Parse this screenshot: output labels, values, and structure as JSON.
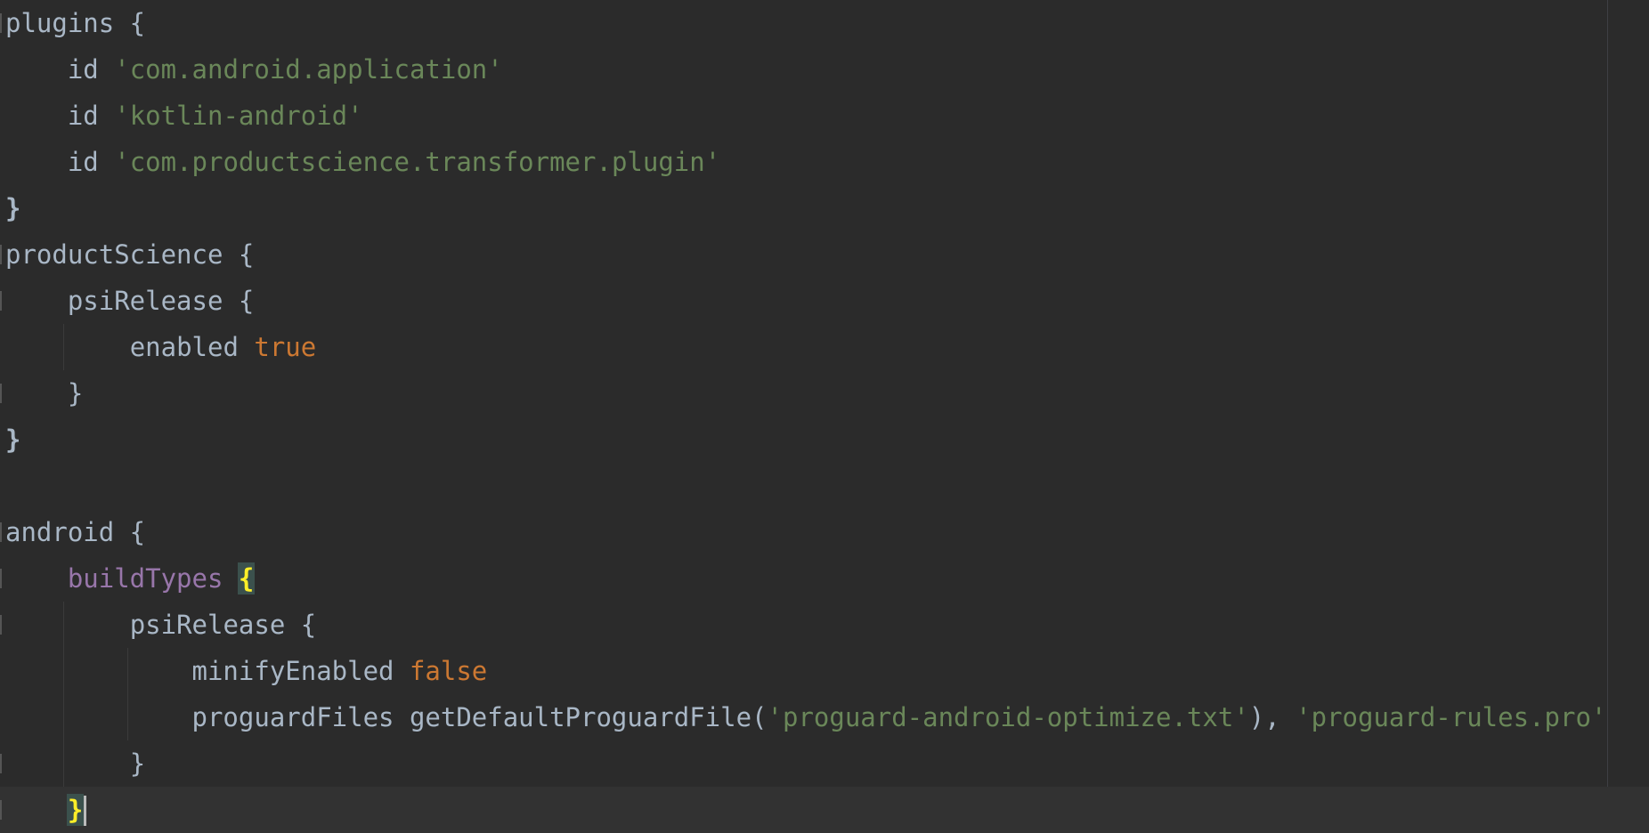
{
  "editor": {
    "lines": [
      {
        "indent": 0,
        "text": "plugins {"
      },
      {
        "indent": 1,
        "keyword": "id",
        "string": "'com.android.application'"
      },
      {
        "indent": 1,
        "keyword": "id",
        "string": "'kotlin-android'"
      },
      {
        "indent": 1,
        "keyword": "id",
        "string": "'com.productscience.transformer.plugin'"
      },
      {
        "indent": 0,
        "text": "}"
      },
      {
        "indent": 0,
        "text": "productScience {"
      },
      {
        "indent": 1,
        "text": "psiRelease {"
      },
      {
        "indent": 2,
        "keyword": "enabled",
        "value": "true"
      },
      {
        "indent": 1,
        "text": "}"
      },
      {
        "indent": 0,
        "text": "}"
      },
      {
        "indent": 0,
        "text": ""
      },
      {
        "indent": 0,
        "text": "android {"
      },
      {
        "indent": 1,
        "identifier": "buildTypes",
        "brace": "{"
      },
      {
        "indent": 2,
        "text": "psiRelease {"
      },
      {
        "indent": 3,
        "keyword": "minifyEnabled",
        "value": "false"
      },
      {
        "indent": 3,
        "prefix": "proguardFiles getDefaultProguardFile(",
        "string1": "'proguard-android-optimize.txt'",
        "middle": "), ",
        "string2": "'proguard-rules.pro'"
      },
      {
        "indent": 2,
        "text": "}"
      },
      {
        "indent": 1,
        "brace": "}"
      }
    ],
    "gutter": {
      "intention_icon": "lightbulb-icon",
      "intention_color": "#f2c55c"
    },
    "colors": {
      "background": "#2b2b2b",
      "current_line": "#323232",
      "text": "#a9b7c6",
      "string": "#6a8759",
      "keyword_value": "#cc7832",
      "property": "#9876aa",
      "matched_brace": "#ffef28"
    }
  }
}
